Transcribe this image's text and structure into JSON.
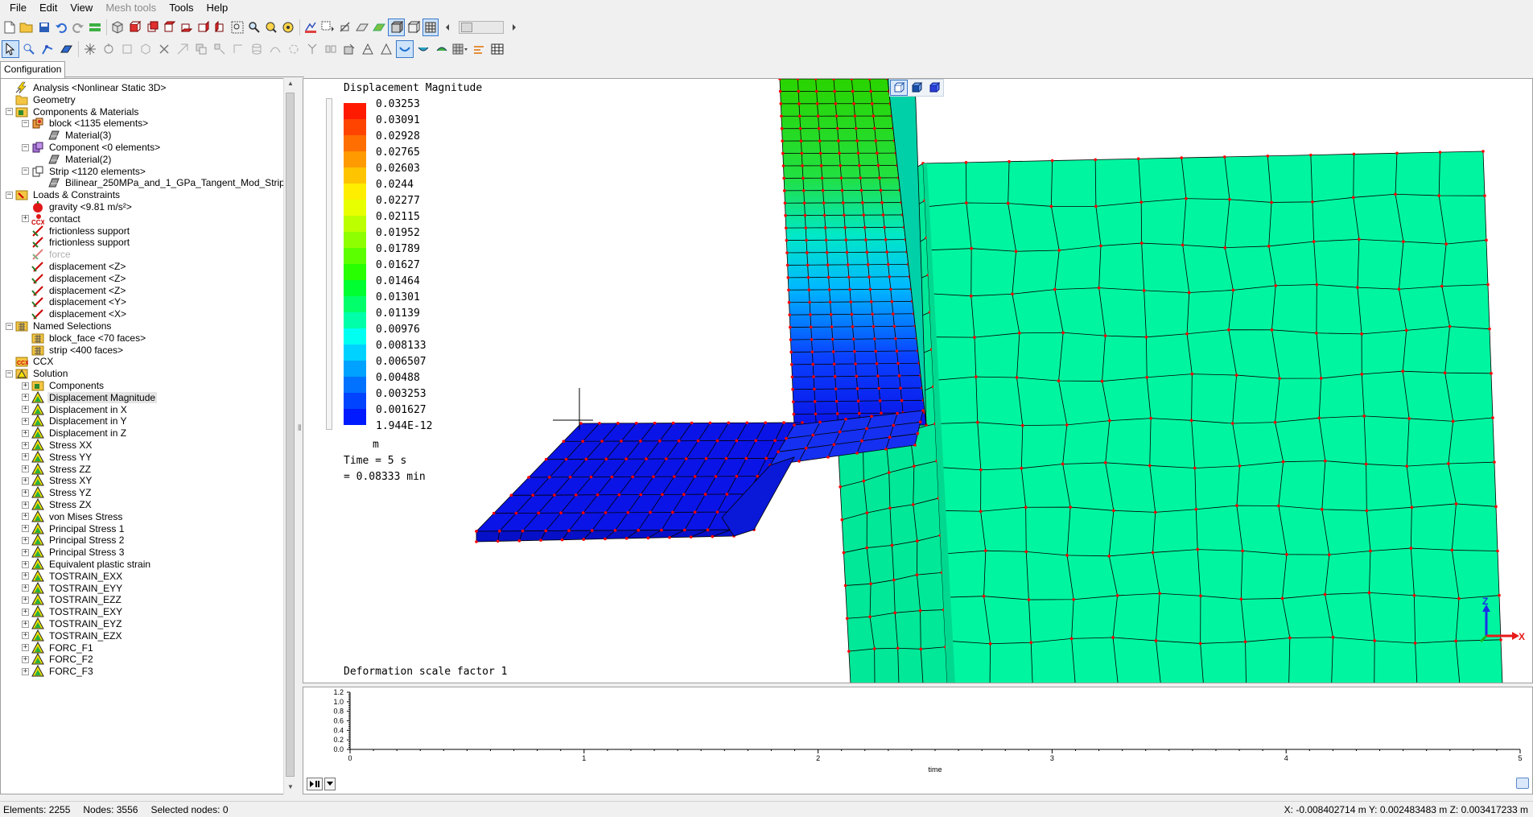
{
  "menubar": {
    "items": [
      {
        "label": "File",
        "enabled": true
      },
      {
        "label": "Edit",
        "enabled": true
      },
      {
        "label": "View",
        "enabled": true
      },
      {
        "label": "Mesh tools",
        "enabled": false
      },
      {
        "label": "Tools",
        "enabled": true
      },
      {
        "label": "Help",
        "enabled": true
      }
    ]
  },
  "tabs": {
    "configuration": "Configuration"
  },
  "tree": {
    "items": [
      {
        "level": 1,
        "exp": "none",
        "icon": "analysis-icon",
        "label": "Analysis <Nonlinear Static 3D>"
      },
      {
        "level": 1,
        "exp": "none",
        "icon": "folder-icon",
        "label": "Geometry"
      },
      {
        "level": 1,
        "exp": "minus",
        "icon": "components-icon",
        "label": "Components & Materials"
      },
      {
        "level": 2,
        "exp": "minus",
        "icon": "part-icon",
        "label": "block <1135 elements>"
      },
      {
        "level": 3,
        "exp": "none",
        "icon": "material-icon",
        "label": "Material(3)"
      },
      {
        "level": 2,
        "exp": "minus",
        "icon": "part-purple-icon",
        "label": "Component <0 elements>"
      },
      {
        "level": 3,
        "exp": "none",
        "icon": "material-icon",
        "label": "Material(2)"
      },
      {
        "level": 2,
        "exp": "minus",
        "icon": "part-outline-icon",
        "label": "Strip <1120 elements>"
      },
      {
        "level": 3,
        "exp": "none",
        "icon": "material-icon",
        "label": "Bilinear_250MPa_and_1_GPa_Tangent_Mod_Strip"
      },
      {
        "level": 1,
        "exp": "minus",
        "icon": "loads-icon",
        "label": "Loads & Constraints"
      },
      {
        "level": 2,
        "exp": "none",
        "icon": "gravity-icon",
        "label": "gravity <9.81 m/s²>"
      },
      {
        "level": 2,
        "exp": "plus",
        "icon": "contact-icon",
        "label": "contact"
      },
      {
        "level": 2,
        "exp": "none",
        "icon": "support-icon",
        "label": "frictionless support"
      },
      {
        "level": 2,
        "exp": "none",
        "icon": "support-icon",
        "label": "frictionless support"
      },
      {
        "level": 2,
        "exp": "none",
        "icon": "force-icon",
        "label": "force",
        "disabled": true
      },
      {
        "level": 2,
        "exp": "none",
        "icon": "displacement-icon",
        "label": "displacement <Z>"
      },
      {
        "level": 2,
        "exp": "none",
        "icon": "displacement-icon",
        "label": "displacement <Z>"
      },
      {
        "level": 2,
        "exp": "none",
        "icon": "displacement-icon",
        "label": "displacement <Z>"
      },
      {
        "level": 2,
        "exp": "none",
        "icon": "displacement-icon",
        "label": "displacement <Y>"
      },
      {
        "level": 2,
        "exp": "none",
        "icon": "displacement-icon",
        "label": "displacement <X>"
      },
      {
        "level": 1,
        "exp": "minus",
        "icon": "selection-icon",
        "label": "Named Selections"
      },
      {
        "level": 2,
        "exp": "none",
        "icon": "selection-icon",
        "label": "block_face <70 faces>"
      },
      {
        "level": 2,
        "exp": "none",
        "icon": "selection-icon",
        "label": "strip <400 faces>"
      },
      {
        "level": 1,
        "exp": "none",
        "icon": "ccx-icon",
        "label": "CCX"
      },
      {
        "level": 1,
        "exp": "minus",
        "icon": "solution-icon",
        "label": "Solution"
      },
      {
        "level": 2,
        "exp": "plus",
        "icon": "components-icon",
        "label": "Components"
      },
      {
        "level": 2,
        "exp": "plus",
        "icon": "result-icon",
        "label": "Displacement Magnitude",
        "selected": true
      },
      {
        "level": 2,
        "exp": "plus",
        "icon": "result-icon",
        "label": "Displacement in X"
      },
      {
        "level": 2,
        "exp": "plus",
        "icon": "result-icon",
        "label": "Displacement in Y"
      },
      {
        "level": 2,
        "exp": "plus",
        "icon": "result-icon",
        "label": "Displacement in Z"
      },
      {
        "level": 2,
        "exp": "plus",
        "icon": "result-icon",
        "label": "Stress XX"
      },
      {
        "level": 2,
        "exp": "plus",
        "icon": "result-icon",
        "label": "Stress YY"
      },
      {
        "level": 2,
        "exp": "plus",
        "icon": "result-icon",
        "label": "Stress ZZ"
      },
      {
        "level": 2,
        "exp": "plus",
        "icon": "result-icon",
        "label": "Stress XY"
      },
      {
        "level": 2,
        "exp": "plus",
        "icon": "result-icon",
        "label": "Stress YZ"
      },
      {
        "level": 2,
        "exp": "plus",
        "icon": "result-icon",
        "label": "Stress ZX"
      },
      {
        "level": 2,
        "exp": "plus",
        "icon": "result-icon",
        "label": "von Mises Stress"
      },
      {
        "level": 2,
        "exp": "plus",
        "icon": "result-icon",
        "label": "Principal Stress 1"
      },
      {
        "level": 2,
        "exp": "plus",
        "icon": "result-icon",
        "label": "Principal Stress 2"
      },
      {
        "level": 2,
        "exp": "plus",
        "icon": "result-icon",
        "label": "Principal Stress 3"
      },
      {
        "level": 2,
        "exp": "plus",
        "icon": "result-icon",
        "label": "Equivalent plastic strain"
      },
      {
        "level": 2,
        "exp": "plus",
        "icon": "result-icon",
        "label": "TOSTRAIN_EXX"
      },
      {
        "level": 2,
        "exp": "plus",
        "icon": "result-icon",
        "label": "TOSTRAIN_EYY"
      },
      {
        "level": 2,
        "exp": "plus",
        "icon": "result-icon",
        "label": "TOSTRAIN_EZZ"
      },
      {
        "level": 2,
        "exp": "plus",
        "icon": "result-icon",
        "label": "TOSTRAIN_EXY"
      },
      {
        "level": 2,
        "exp": "plus",
        "icon": "result-icon",
        "label": "TOSTRAIN_EYZ"
      },
      {
        "level": 2,
        "exp": "plus",
        "icon": "result-icon",
        "label": "TOSTRAIN_EZX"
      },
      {
        "level": 2,
        "exp": "plus",
        "icon": "result-icon",
        "label": "FORC_F1"
      },
      {
        "level": 2,
        "exp": "plus",
        "icon": "result-icon",
        "label": "FORC_F2"
      },
      {
        "level": 2,
        "exp": "plus",
        "icon": "result-icon",
        "label": "FORC_F3"
      }
    ]
  },
  "viewport": {
    "legend": {
      "title": "Displacement Magnitude",
      "values": [
        "0.03253",
        "0.03091",
        "0.02928",
        "0.02765",
        "0.02603",
        "0.0244",
        "0.02277",
        "0.02115",
        "0.01952",
        "0.01789",
        "0.01627",
        "0.01464",
        "0.01301",
        "0.01139",
        "0.00976",
        "0.008133",
        "0.006507",
        "0.00488",
        "0.003253",
        "0.001627",
        "1.944E-12"
      ],
      "colors": [
        "#ff1a00",
        "#ff4400",
        "#ff6e00",
        "#ff9a00",
        "#ffc400",
        "#ffee00",
        "#e8ff00",
        "#bcff00",
        "#8eff00",
        "#5cff00",
        "#28ff00",
        "#00ff30",
        "#00ff6a",
        "#00ffa8",
        "#00fff0",
        "#00d2ff",
        "#00a2ff",
        "#0072ff",
        "#0044ff",
        "#001aff"
      ],
      "unit": "m"
    },
    "time_line1": "Time = 5 s",
    "time_line2": "= 0.08333 min",
    "deformation_scale": "Deformation scale factor 1",
    "triad": {
      "z": "Z",
      "x": "X"
    },
    "colors": {
      "block": "#00f5a0",
      "mesh_line": "#000000",
      "node": "#ff0000",
      "strip": "#0a14e6"
    }
  },
  "plot": {
    "yticks": [
      "1.2",
      "1.0",
      "0.8",
      "0.6",
      "0.4",
      "0.2",
      "0.0"
    ],
    "xticks": [
      "0",
      "1",
      "2",
      "3",
      "4",
      "5"
    ],
    "xlabel": "time"
  },
  "status": {
    "elements": "Elements: 2255",
    "nodes": "Nodes: 3556",
    "selected_nodes": "Selected nodes: 0",
    "coordinates": "X: -0.008402714 m Y: 0.002483483 m Z: 0.003417233 m"
  }
}
